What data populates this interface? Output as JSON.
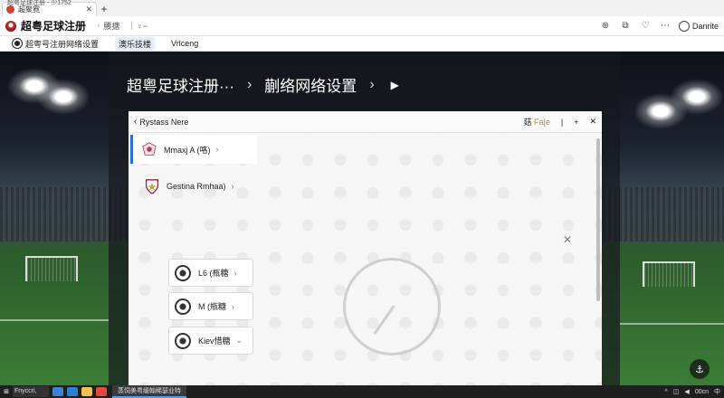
{
  "window": {
    "caption": "超粤足球注册 - 少1752"
  },
  "tab": {
    "title": "超聚霓",
    "close": "✕",
    "new": "+"
  },
  "toolbar": {
    "app_title": "超粤足球注册",
    "sep1": "›",
    "nav2": "腰搪",
    "sep2": "|",
    "nav3": "♀~",
    "icons": [
      "⊕",
      "⧉",
      "♡",
      "⋯"
    ],
    "user": "Danrite"
  },
  "bookmarks": [
    {
      "label": "超粤号注册网络设置",
      "active": false
    },
    {
      "label": "澳乐技楼",
      "active": true
    },
    {
      "label": "Vrlceng",
      "active": false
    }
  ],
  "breadcrumb": {
    "part1": "超粤足球注册···",
    "chev1": "›",
    "part2": "蒯络网络设置",
    "chev2": "›",
    "play": "▶"
  },
  "panel": {
    "header_back": "‹",
    "header_title": "Rystass Nere",
    "dict_prefix": "菇",
    "dict_accent": "Fa|e",
    "add": "+",
    "close": "✕"
  },
  "items": [
    {
      "label": "Mmaxj A (咯)",
      "chevron": "›"
    },
    {
      "label": "Gestina Rmhaa)",
      "chevron": "›"
    }
  ],
  "children": [
    {
      "label": "L6 (瓶糖",
      "chevron": "›"
    },
    {
      "label": "M (瓶糖",
      "chevron": "›"
    },
    {
      "label": "Kiev惜糖",
      "chevron": "⌄"
    }
  ],
  "row_close": "✕",
  "fab_icon": "⚓",
  "taskbar": {
    "start": "⊞",
    "search": "Fnyccri,",
    "active_window": "蒸饲美粤缓翰稀瑟业特",
    "tray_up": "^",
    "time": "00cn",
    "lang": "中"
  }
}
